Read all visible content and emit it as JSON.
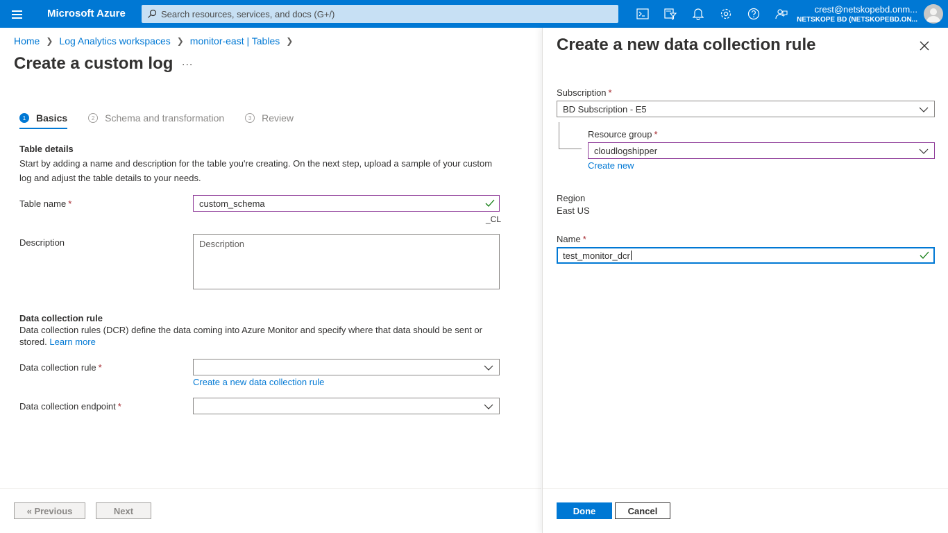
{
  "topbar": {
    "brand": "Microsoft Azure",
    "search_placeholder": "Search resources, services, and docs (G+/)",
    "account_email": "crest@netskopebd.onm...",
    "account_tenant": "NETSKOPE BD (NETSKOPEBD.ON...",
    "icons": [
      "cloud-shell-icon",
      "directory-filter-icon",
      "notifications-icon",
      "settings-icon",
      "help-icon",
      "feedback-icon"
    ]
  },
  "breadcrumb": {
    "items": [
      "Home",
      "Log Analytics workspaces",
      "monitor-east | Tables"
    ]
  },
  "page": {
    "title": "Create a custom log",
    "more": "..."
  },
  "steps": [
    {
      "num": "1",
      "label": "Basics",
      "state": "active"
    },
    {
      "num": "2",
      "label": "Schema and transformation",
      "state": "inactive"
    },
    {
      "num": "3",
      "label": "Review",
      "state": "inactive"
    }
  ],
  "table_details": {
    "title": "Table details",
    "description": "Start by adding a name and description for the table you're creating. On the next step, upload a sample of your custom log and adjust the table details to your needs.",
    "table_name_label": "Table name",
    "table_name_value": "custom_schema",
    "table_name_suffix": "_CL",
    "description_label": "Description",
    "description_placeholder": "Description"
  },
  "dcr_section": {
    "title": "Data collection rule",
    "description": "Data collection rules (DCR) define the data coming into Azure Monitor and specify where that data should be sent or stored.",
    "learn_more": "Learn more",
    "dcr_label": "Data collection rule",
    "dcr_value": "",
    "create_dcr_link": "Create a new data collection rule",
    "dce_label": "Data collection endpoint",
    "dce_value": ""
  },
  "left_footer": {
    "previous": "« Previous",
    "next": "Next"
  },
  "right_blade": {
    "title": "Create a new data collection rule",
    "subscription_label": "Subscription",
    "subscription_value": "BD Subscription - E5",
    "resource_group_label": "Resource group",
    "resource_group_value": "cloudlogshipper",
    "create_new": "Create new",
    "region_label": "Region",
    "region_value": "East US",
    "name_label": "Name",
    "name_value": "test_monitor_dcr",
    "done": "Done",
    "cancel": "Cancel"
  },
  "colors": {
    "azure_blue": "#0078d4",
    "valid_border": "#8e3a98",
    "required": "#a4262c",
    "success_check": "#107c10"
  }
}
